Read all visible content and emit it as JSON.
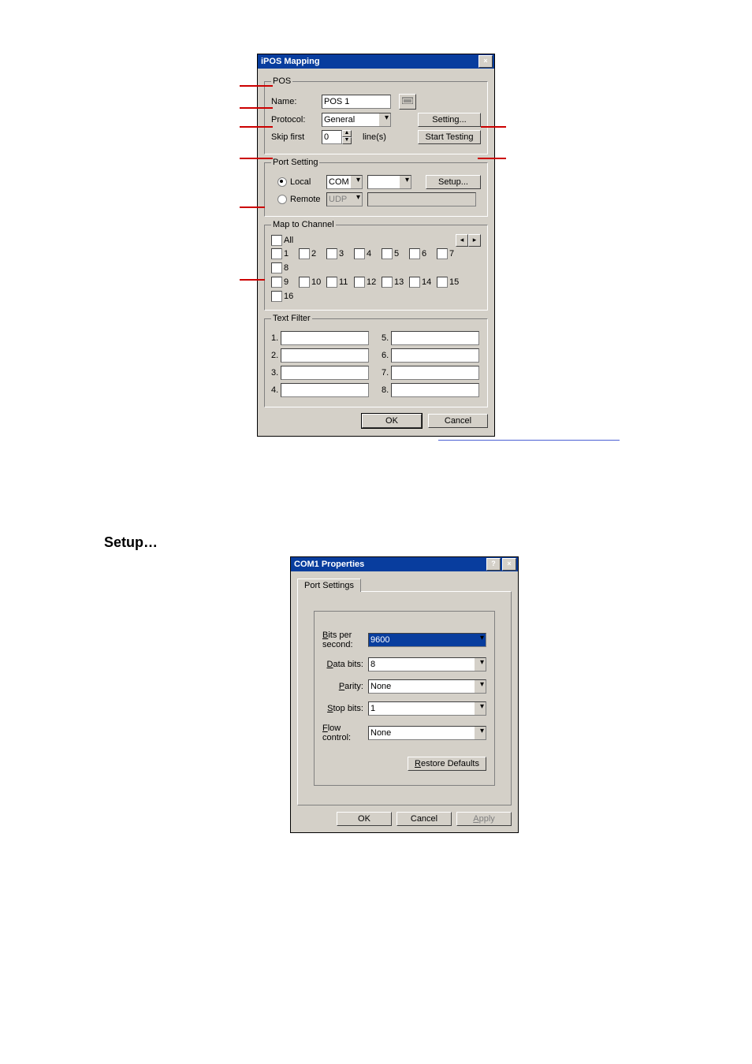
{
  "dialog1": {
    "title": "iPOS Mapping",
    "pos_group": "POS",
    "name_label": "Name:",
    "name_value": "POS 1",
    "protocol_label": "Protocol:",
    "protocol_value": "General",
    "setting_btn": "Setting...",
    "skip_label": "Skip  first",
    "skip_value": "0",
    "skip_unit": "line(s)",
    "start_btn": "Start Testing",
    "port_group": "Port Setting",
    "local_label": "Local",
    "remote_label": "Remote",
    "local_proto": "COM",
    "remote_proto": "UDP",
    "setup_btn": "Setup...",
    "map_group": "Map to Channel",
    "all_label": "All",
    "channels_row1": [
      "1",
      "2",
      "3",
      "4",
      "5",
      "6",
      "7",
      "8"
    ],
    "channels_row2": [
      "9",
      "10",
      "11",
      "12",
      "13",
      "14",
      "15",
      "16"
    ],
    "filter_group": "Text Filter",
    "filter_left": [
      "1.",
      "2.",
      "3.",
      "4."
    ],
    "filter_right": [
      "5.",
      "6.",
      "7.",
      "8."
    ],
    "ok": "OK",
    "cancel": "Cancel"
  },
  "section_heading": "Setup…",
  "dialog2": {
    "title": "COM1 Properties",
    "tab": "Port Settings",
    "fields": {
      "bits_label": "Bits per second:",
      "bits_value": "9600",
      "data_label": "Data bits:",
      "data_value": "8",
      "parity_label": "Parity:",
      "parity_value": "None",
      "stop_label": "Stop bits:",
      "stop_value": "1",
      "flow_label": "Flow control:",
      "flow_value": "None"
    },
    "restore_btn": "Restore Defaults",
    "ok": "OK",
    "cancel": "Cancel",
    "apply": "Apply"
  }
}
